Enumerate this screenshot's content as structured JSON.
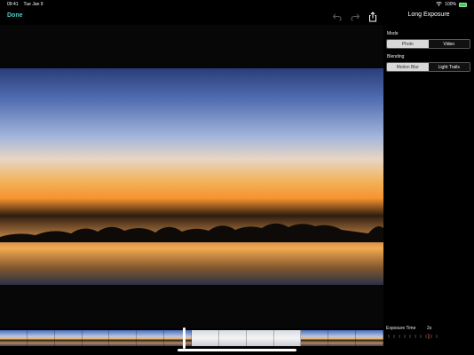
{
  "status": {
    "time": "09:41",
    "date": "Tue Jan 9",
    "battery_percent": "100%",
    "battery_level": 1.0
  },
  "toolbar": {
    "done_label": "Done",
    "icons": [
      "undo-icon",
      "redo-icon",
      "share-icon"
    ]
  },
  "panel": {
    "title": "Long Exposure",
    "mode": {
      "label": "Mode",
      "options": [
        "Photo",
        "Video"
      ],
      "selected": "Photo"
    },
    "blending": {
      "label": "Blending",
      "options": [
        "Motion Blur",
        "Light Trails"
      ],
      "selected": "Motion Blur"
    },
    "exposure": {
      "label": "Exposure Time",
      "value": "2s"
    }
  },
  "colors": {
    "accent": "#4fd0c2",
    "battery": "#39d353",
    "background": "#000000"
  }
}
